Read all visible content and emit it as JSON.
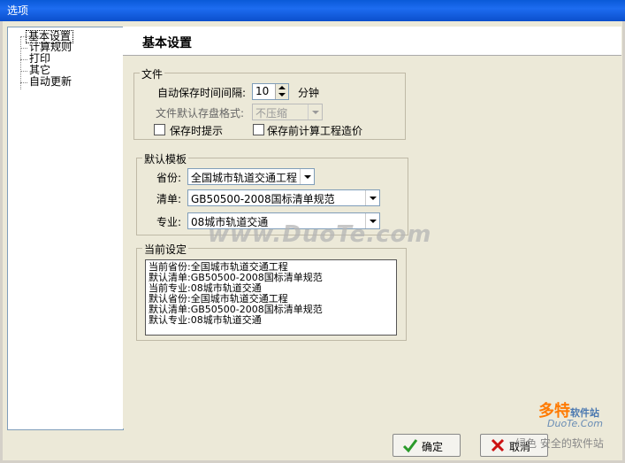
{
  "window": {
    "title": "选项"
  },
  "tree": {
    "items": [
      "基本设置",
      "计算规则",
      "打印",
      "其它",
      "自动更新"
    ]
  },
  "header": {
    "title": "基本设置"
  },
  "file_group": {
    "legend": "文件",
    "autosave_label": "自动保存时间间隔:",
    "autosave_value": "10",
    "autosave_unit": "分钟",
    "format_label": "文件默认存盘格式:",
    "format_value": "不压缩",
    "save_prompt_label": "保存时提示",
    "calc_before_save_label": "保存前计算工程造价"
  },
  "template_group": {
    "legend": "默认模板",
    "province_label": "省份:",
    "province_value": "全国城市轨道交通工程",
    "list_label": "清单:",
    "list_value": "GB50500-2008国标清单规范",
    "major_label": "专业:",
    "major_value": "08城市轨道交通"
  },
  "current_group": {
    "legend": "当前设定",
    "lines": [
      "当前省份:全国城市轨道交通工程",
      "默认清单:GB50500-2008国标清单规范",
      "当前专业:08城市轨道交通",
      "默认省份:全国城市轨道交通工程",
      "默认清单:GB50500-2008国标清单规范",
      "默认专业:08城市轨道交通"
    ]
  },
  "buttons": {
    "ok": "确定",
    "cancel": "取消"
  },
  "watermark": {
    "text": "www.DuoTe.com",
    "logo": "多特",
    "logo_tag": "软件站",
    "sub": "DuoTe.Com",
    "tagline": "绿色 安全的软件站"
  },
  "colors": {
    "titlebar": "#0a5ad8",
    "ok_icon": "#2a9a2a",
    "cancel_icon": "#cc1111"
  }
}
